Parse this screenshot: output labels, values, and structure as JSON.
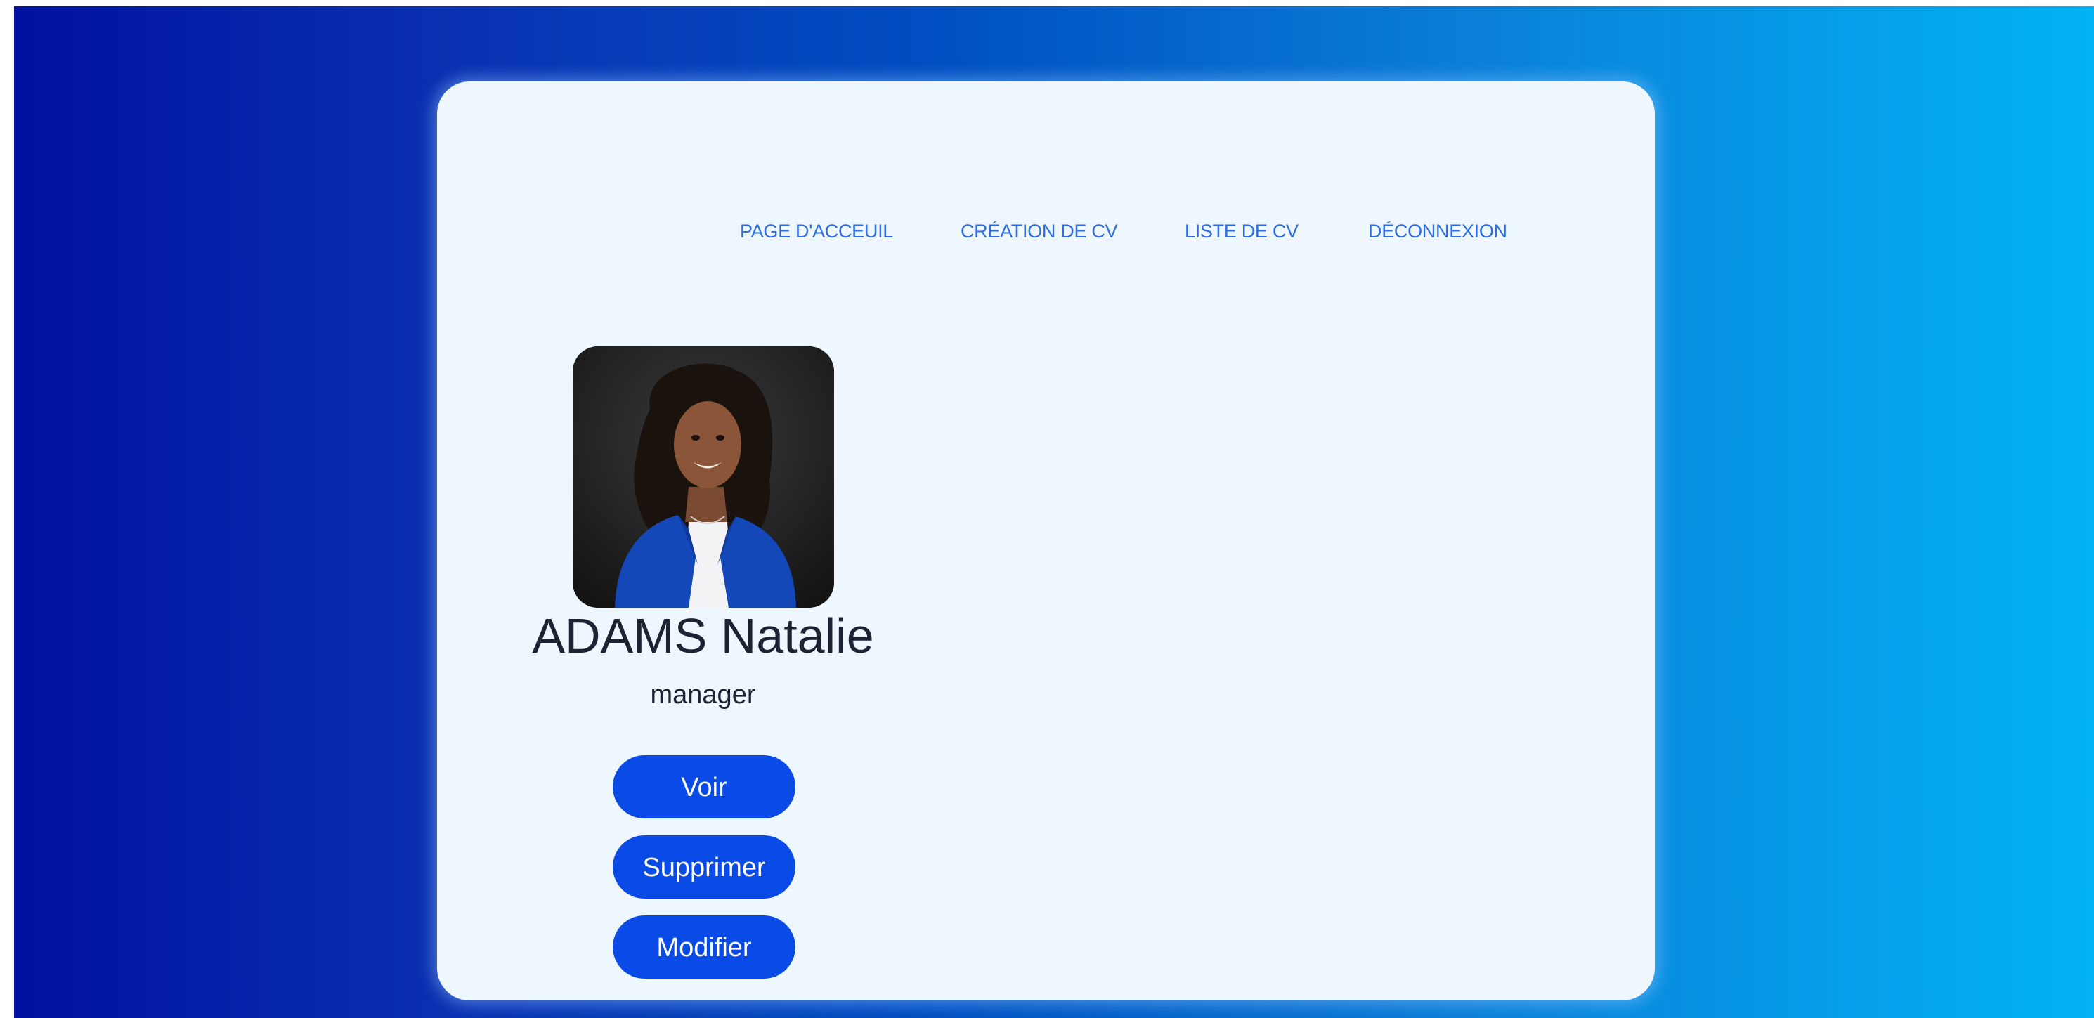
{
  "nav": {
    "home": "PAGE D'ACCEUIL",
    "create_cv": "CRÉATION DE CV",
    "cv_list": "LISTE DE CV",
    "logout": "DÉCONNEXION"
  },
  "profile": {
    "name": "ADAMS Natalie",
    "role": "manager",
    "photo_icon": "profile-photo"
  },
  "actions": {
    "view": "Voir",
    "delete": "Supprimer",
    "edit": "Modifier"
  },
  "colors": {
    "accent": "#0a4ae6",
    "nav_link": "#2f6ee0",
    "card_bg": "#eef7fd",
    "gradient_start": "#0011a0",
    "gradient_end": "#02b3f5"
  }
}
